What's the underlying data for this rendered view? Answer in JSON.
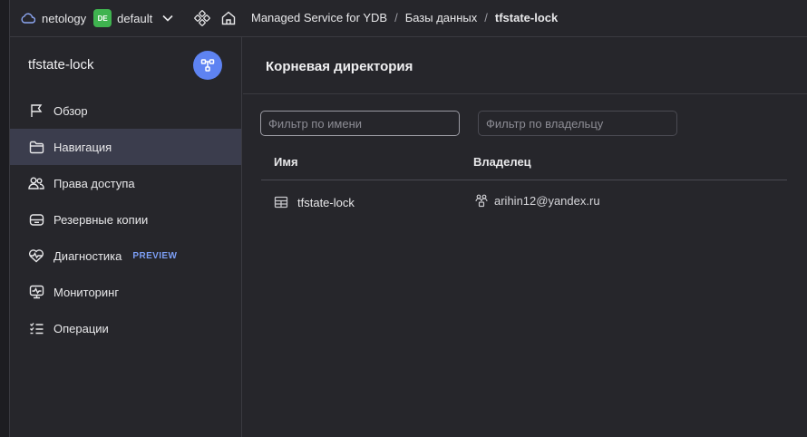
{
  "topbar": {
    "cloud": "netology",
    "folder_badge": "DE",
    "folder": "default",
    "breadcrumbs": [
      "Managed Service for YDB",
      "Базы данных",
      "tfstate-lock"
    ],
    "separator": "/"
  },
  "sidebar": {
    "title": "tfstate-lock",
    "items": [
      {
        "label": "Обзор",
        "icon": "flag-icon"
      },
      {
        "label": "Навигация",
        "icon": "folder-icon",
        "active": true
      },
      {
        "label": "Права доступа",
        "icon": "users-icon"
      },
      {
        "label": "Резервные копии",
        "icon": "backup-icon"
      },
      {
        "label": "Диагностика",
        "icon": "heart-pulse-icon",
        "badge": "PREVIEW"
      },
      {
        "label": "Мониторинг",
        "icon": "monitor-icon"
      },
      {
        "label": "Операции",
        "icon": "list-icon"
      }
    ]
  },
  "main": {
    "title": "Корневая директория",
    "filter_name_placeholder": "Фильтр по имени",
    "filter_owner_placeholder": "Фильтр по владельцу",
    "columns": [
      "Имя",
      "Владелец"
    ],
    "rows": [
      {
        "name": "tfstate-lock",
        "owner": "arihin12@yandex.ru"
      }
    ]
  },
  "colors": {
    "background": "#26262b",
    "active_item": "#3b3d4d",
    "accent": "#5e83f2",
    "folder_badge": "#3fb34f",
    "preview": "#7c9ef5"
  }
}
